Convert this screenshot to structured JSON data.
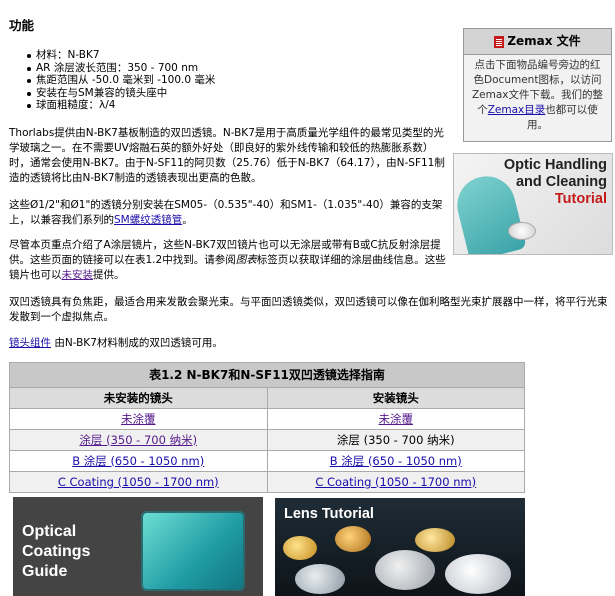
{
  "heading": "功能",
  "features": [
    "材料：N-BK7",
    "AR 涂层波长范围：350 - 700 nm",
    "焦距范围从 -50.0 毫米到 -100.0 毫米",
    "安装在与SM兼容的镜头座中",
    "球面粗糙度：λ/4"
  ],
  "paragraphs": {
    "p1": "Thorlabs提供由N-BK7基板制造的双凹透镜。N-BK7是用于高质量光学组件的最常见类型的光学玻璃之一。在不需要UV熔融石英的额外好处（即良好的紫外线传输和较低的热膨胀系数）时，通常会使用N-BK7。由于N-SF11的阿贝数（25.76）低于N-BK7（64.17），由N-SF11制造的透镜将比由N-BK7制造的透镜表现出更高的色散。",
    "p2_text": "这些Ø1/2\"和Ø1\"的透镜分别安装在SM05-（0.535\"-40）和SM1-（1.035\"-40）兼容的支架上，以兼容我们系列的",
    "p2_link": "SM螺纹透镜管",
    "p2_end": "。",
    "p3_text": "尽管本页重点介绍了A涂层镜片，这些N-BK7双凹镜片也可以无涂层或带有B或C抗反射涂层提供。这些页面的链接可以在表1.2中找到。请参阅",
    "p3_italic": "图表",
    "p3_text2": "标签页以获取详细的涂层曲线信息。这些镜片也可以",
    "p3_link": "未安装",
    "p3_end": "提供。",
    "p4": "双凹透镜具有负焦距，最适合用来发散会聚光束。与平面凹透镜类似，双凹透镜可以像在伽利略型光束扩展器中一样，将平行光束发散到一个虚拟焦点。",
    "p5_link": "镜头组件",
    "p5_text": " 由N-BK7材料制成的双凹透镜可用。"
  },
  "zemax": {
    "title": "Zemax 文件",
    "body_1": "点击下面物品编号旁边的红色Document图标，以访问Zemax文件下载。我们的整个",
    "body_link": "Zemax目录",
    "body_2": "也都可以使用。"
  },
  "optic_banner": {
    "line1": "Optic Handling",
    "line2": "and Cleaning",
    "line3": "Tutorial"
  },
  "table": {
    "caption": "表1.2 N-BK7和N-SF11双凹透镜选择指南",
    "col_unmounted": "未安装的镜头",
    "col_mounted": "安装镜头",
    "rows": [
      {
        "left": "未涂覆",
        "right": "未涂覆"
      },
      {
        "left": "涂层 (350 - 700 纳米)",
        "right": "涂层 (350 - 700 纳米)"
      },
      {
        "left": "B 涂层 (650 - 1050 nm)",
        "right": "B 涂层 (650 - 1050 nm)"
      },
      {
        "left": "C Coating (1050 - 1700 nm)",
        "right": "C Coating (1050 - 1700 nm)"
      }
    ]
  },
  "coatings_banner": {
    "line1": "Optical",
    "line2": "Coatings",
    "line3": "Guide"
  },
  "lens_banner": {
    "title": "Lens Tutorial"
  }
}
